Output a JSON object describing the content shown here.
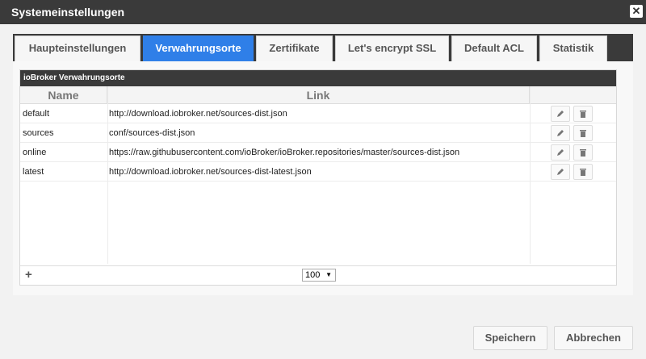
{
  "window": {
    "title": "Systemeinstellungen",
    "close_symbol": "✕"
  },
  "tabs": [
    {
      "label": "Haupteinstellungen",
      "active": false
    },
    {
      "label": "Verwahrungsorte",
      "active": true
    },
    {
      "label": "Zertifikate",
      "active": false
    },
    {
      "label": "Let's encrypt SSL",
      "active": false
    },
    {
      "label": "Default ACL",
      "active": false
    },
    {
      "label": "Statistik",
      "active": false
    }
  ],
  "grid": {
    "caption": "ioBroker Verwahrungsorte",
    "columns": [
      "Name",
      "Link"
    ],
    "rows": [
      {
        "name": "default",
        "link": "http://download.iobroker.net/sources-dist.json"
      },
      {
        "name": "sources",
        "link": "conf/sources-dist.json"
      },
      {
        "name": "online",
        "link": "https://raw.githubusercontent.com/ioBroker/ioBroker.repositories/master/sources-dist.json"
      },
      {
        "name": "latest",
        "link": "http://download.iobroker.net/sources-dist-latest.json"
      }
    ],
    "row_actions": [
      "edit-icon",
      "delete-icon"
    ],
    "add_symbol": "+",
    "page_size": "100"
  },
  "buttons": {
    "save": "Speichern",
    "cancel": "Abbrechen"
  },
  "colors": {
    "accent": "#2f7fe8",
    "titlebar": "#3a3a3a"
  }
}
